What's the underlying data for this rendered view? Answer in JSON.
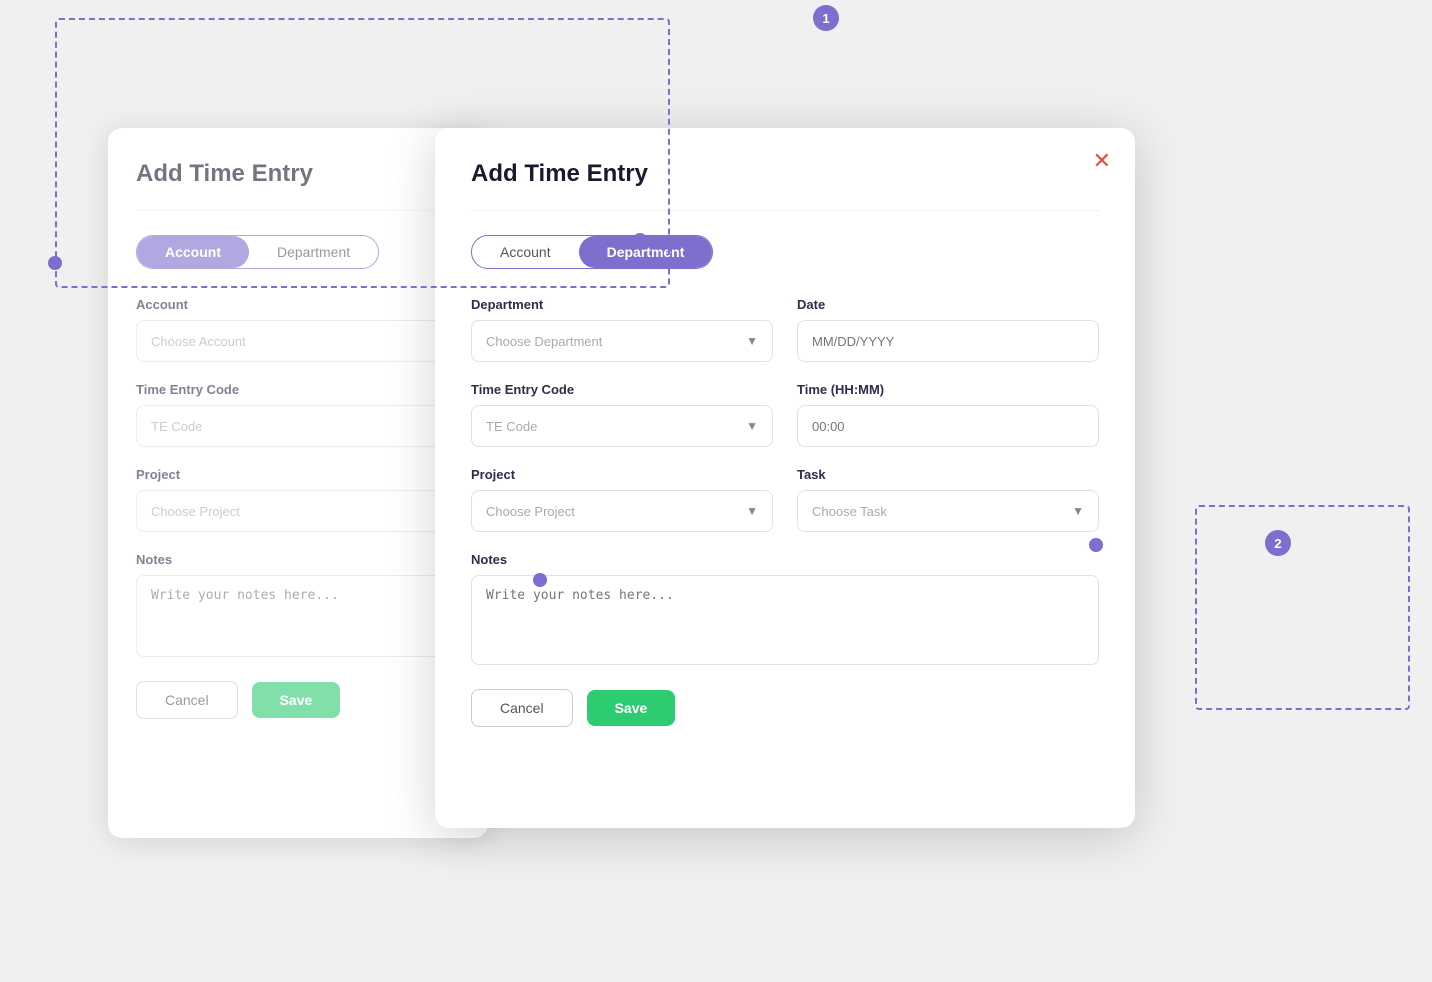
{
  "annotations": {
    "dot1_label": "1",
    "dot2_label": "2"
  },
  "dialog_bg": {
    "title": "Add Time Entry",
    "tab_account": "Account",
    "tab_department": "Department",
    "account_label": "Account",
    "account_placeholder": "Choose Account",
    "te_code_label": "Time Entry Code",
    "te_code_placeholder": "TE Code",
    "project_label": "Project",
    "project_placeholder": "Choose Project",
    "notes_label": "Notes",
    "notes_placeholder": "Write your notes here...",
    "cancel_label": "Cancel",
    "save_label": "Save"
  },
  "dialog_fg": {
    "title": "Add Time Entry",
    "tab_account": "Account",
    "tab_department": "Department",
    "close_icon": "✕",
    "department_label": "Department",
    "department_placeholder": "Choose Department",
    "date_label": "Date",
    "date_placeholder": "MM/DD/YYYY",
    "te_code_label": "Time Entry Code",
    "te_code_placeholder": "TE Code",
    "time_label": "Time (HH:MM)",
    "time_placeholder": "00:00",
    "project_label": "Project",
    "project_placeholder": "Choose Project",
    "task_label": "Task",
    "task_placeholder": "Choose Task",
    "notes_label": "Notes",
    "notes_placeholder": "Write your notes here...",
    "cancel_label": "Cancel",
    "save_label": "Save"
  }
}
